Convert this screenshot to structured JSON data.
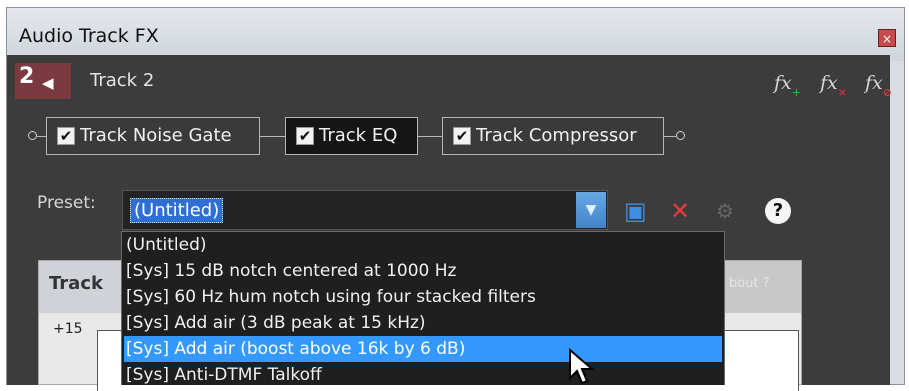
{
  "window": {
    "title": "Audio Track FX",
    "close_glyph": "×"
  },
  "track": {
    "number": "2",
    "name": "Track 2",
    "speaker_icon": "speaker-icon"
  },
  "fx_buttons": [
    {
      "icon": "fx-add-icon",
      "label": "fx",
      "mark": "+"
    },
    {
      "icon": "fx-remove-icon",
      "label": "fx",
      "mark": "×"
    },
    {
      "icon": "fx-bypass-icon",
      "label": "fx",
      "mark": "⊘"
    }
  ],
  "chain": [
    {
      "label": "Track Noise Gate",
      "checked": true,
      "active": false
    },
    {
      "label": "Track EQ",
      "checked": true,
      "active": true
    },
    {
      "label": "Track Compressor",
      "checked": true,
      "active": false
    }
  ],
  "preset": {
    "label": "Preset:",
    "value": "(Untitled)",
    "options": [
      "(Untitled)",
      "[Sys] 15 dB notch centered at 1000 Hz",
      "[Sys] 60 Hz hum notch using four stacked filters",
      "[Sys] Add air (3 dB peak at 15 kHz)",
      "[Sys] Add air (boost above 16k by 6 dB)",
      "[Sys] Anti-DTMF Talkoff"
    ],
    "highlighted_index": 4
  },
  "plugin_panel": {
    "title": "Track",
    "about_label": "bout ?",
    "scale_top": "+15"
  },
  "colors": {
    "accent": "#3399ff",
    "track_badge": "#7a3a3f",
    "panel_bg": "#3c3c3c"
  }
}
